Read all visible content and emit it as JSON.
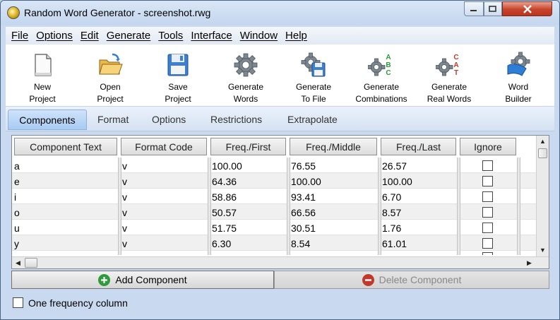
{
  "window": {
    "title": "Random Word Generator - screenshot.rwg"
  },
  "menu": [
    "File",
    "Options",
    "Edit",
    "Generate",
    "Tools",
    "Interface",
    "Window",
    "Help"
  ],
  "toolbar": [
    {
      "icon": "new-document-icon",
      "line1": "New",
      "line2": "Project"
    },
    {
      "icon": "open-folder-icon",
      "line1": "Open",
      "line2": "Project"
    },
    {
      "icon": "floppy-disk-icon",
      "line1": "Save",
      "line2": "Project"
    },
    {
      "icon": "gear-icon",
      "line1": "Generate",
      "line2": "Words"
    },
    {
      "icon": "gear-disk-icon",
      "line1": "Generate",
      "line2": "To File"
    },
    {
      "icon": "gear-abc-icon",
      "line1": "Generate",
      "line2": "Combinations"
    },
    {
      "icon": "gear-cat-icon",
      "line1": "Generate",
      "line2": "Real Words"
    },
    {
      "icon": "word-builder-icon",
      "line1": "Word",
      "line2": "Builder"
    }
  ],
  "abc_letters": [
    "A",
    "B",
    "C"
  ],
  "cat_letters": [
    "C",
    "A",
    "T"
  ],
  "tabs": [
    "Components",
    "Format",
    "Options",
    "Restrictions",
    "Extrapolate"
  ],
  "grid": {
    "columns": [
      "Component Text",
      "Format Code",
      "Freq./First",
      "Freq./Middle",
      "Freq./Last",
      "Ignore"
    ],
    "rows": [
      {
        "text": "a",
        "format": "v",
        "first": "100.00",
        "middle": "76.55",
        "last": "26.57",
        "ignore": false
      },
      {
        "text": "e",
        "format": "v",
        "first": "64.36",
        "middle": "100.00",
        "last": "100.00",
        "ignore": false
      },
      {
        "text": "i",
        "format": "v",
        "first": "58.86",
        "middle": "93.41",
        "last": "6.70",
        "ignore": false
      },
      {
        "text": "o",
        "format": "v",
        "first": "50.57",
        "middle": "66.56",
        "last": "8.57",
        "ignore": false
      },
      {
        "text": "u",
        "format": "v",
        "first": "51.75",
        "middle": "30.51",
        "last": "1.76",
        "ignore": false
      },
      {
        "text": "y",
        "format": "v",
        "first": "6.30",
        "middle": "8.54",
        "last": "61.01",
        "ignore": false
      }
    ]
  },
  "buttons": {
    "add": "Add Component",
    "delete": "Delete Component"
  },
  "footer": {
    "one_freq_label": "One frequency column",
    "checked": false
  },
  "colors": {
    "add_icon": "#2e9a3a",
    "delete_icon": "#c0392b",
    "close_button": "#c7432a"
  }
}
